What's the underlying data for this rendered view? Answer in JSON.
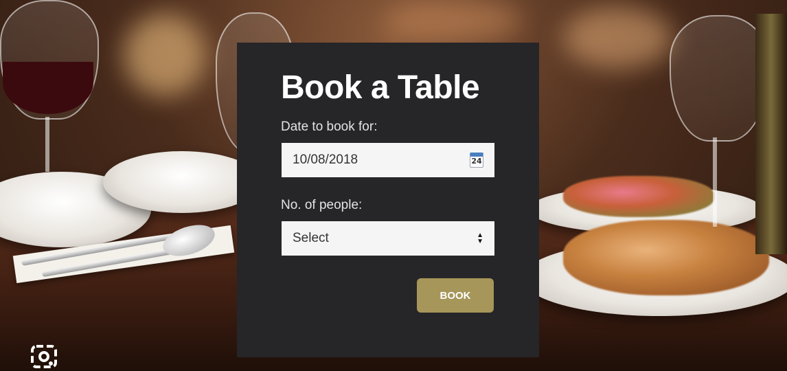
{
  "booking": {
    "title": "Book a Table",
    "date_label": "Date to book for:",
    "date_value": "10/08/2018",
    "calendar_day": "24",
    "people_label": "No. of people:",
    "people_value": "Select",
    "book_label": "BOOK"
  },
  "icons": {
    "calendar": "calendar-icon",
    "select_arrows": "select-arrows-icon",
    "lens": "lens-icon"
  },
  "colors": {
    "card_background": "#262528",
    "field_background": "#f5f5f5",
    "button_background": "#a69659",
    "title_text": "#ffffff"
  }
}
